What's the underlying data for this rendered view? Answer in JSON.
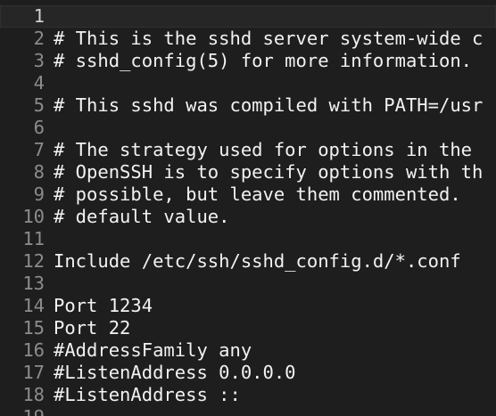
{
  "editor": {
    "current_line": 1,
    "lines": [
      {
        "number": "1",
        "text": ""
      },
      {
        "number": "2",
        "text": "# This is the sshd server system-wide c"
      },
      {
        "number": "3",
        "text": "# sshd_config(5) for more information."
      },
      {
        "number": "4",
        "text": ""
      },
      {
        "number": "5",
        "text": "# This sshd was compiled with PATH=/usr"
      },
      {
        "number": "6",
        "text": ""
      },
      {
        "number": "7",
        "text": "# The strategy used for options in the"
      },
      {
        "number": "8",
        "text": "# OpenSSH is to specify options with th"
      },
      {
        "number": "9",
        "text": "# possible, but leave them commented."
      },
      {
        "number": "10",
        "text": "# default value."
      },
      {
        "number": "11",
        "text": ""
      },
      {
        "number": "12",
        "text": "Include /etc/ssh/sshd_config.d/*.conf"
      },
      {
        "number": "13",
        "text": ""
      },
      {
        "number": "14",
        "text": "Port 1234"
      },
      {
        "number": "15",
        "text": "Port 22"
      },
      {
        "number": "16",
        "text": "#AddressFamily any"
      },
      {
        "number": "17",
        "text": "#ListenAddress 0.0.0.0"
      },
      {
        "number": "18",
        "text": "#ListenAddress ::"
      },
      {
        "number": "19",
        "text": ""
      }
    ]
  }
}
